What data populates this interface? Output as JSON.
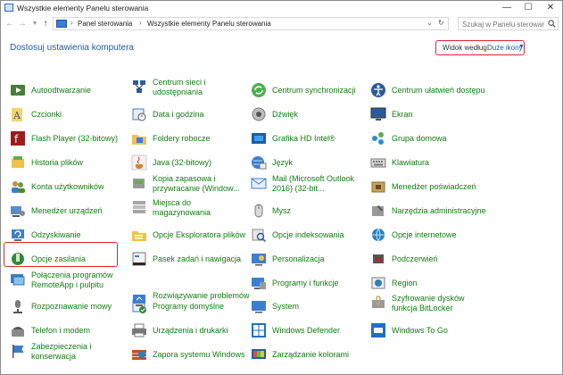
{
  "window": {
    "title": "Wszystkie elementy Panelu sterowania"
  },
  "address": {
    "crumbs": [
      "Panel sterowania",
      "Wszystkie elementy Panelu sterowania"
    ],
    "search_placeholder": "Szukaj w Panelu sterowania"
  },
  "header": {
    "title": "Dostosuj ustawienia komputera",
    "view_by_label": "Widok według:",
    "view_by_value": "Duże ikony"
  },
  "colors": {
    "link_green": "#107c10",
    "heading_blue": "#1e5aa8",
    "highlight_red": "#e0242f"
  },
  "items": {
    "c1": [
      {
        "label": "Autoodtwarzanie",
        "icon": "autoplay-icon"
      },
      {
        "label": "Czcionki",
        "icon": "fonts-icon"
      },
      {
        "label": "Flash Player (32-bitowy)",
        "icon": "flash-icon"
      },
      {
        "label": "Historia plików",
        "icon": "file-history-icon"
      },
      {
        "label": "Konta użytkowników",
        "icon": "user-accounts-icon"
      },
      {
        "label": "Menedżer urządzeń",
        "icon": "device-manager-icon"
      },
      {
        "label": "Odzyskiwanie",
        "icon": "recovery-icon"
      },
      {
        "label": "Opcje zasilania",
        "icon": "power-options-icon"
      },
      {
        "label": "Połączenia programów RemoteApp i pulpitu",
        "icon": "remoteapp-icon"
      },
      {
        "label": "Rozpoznawanie mowy",
        "icon": "speech-icon"
      },
      {
        "label": "Telefon i modem",
        "icon": "phone-modem-icon"
      },
      {
        "label": "Zabezpieczenia i konserwacja",
        "icon": "security-flag-icon"
      }
    ],
    "c2": [
      {
        "label": "Centrum sieci i udostępniania",
        "icon": "network-icon"
      },
      {
        "label": "Data i godzina",
        "icon": "date-time-icon"
      },
      {
        "label": "Foldery robocze",
        "icon": "work-folders-icon"
      },
      {
        "label": "Java (32-bitowy)",
        "icon": "java-icon"
      },
      {
        "label": "Kopia zapasowa i przywracanie (Window...",
        "icon": "backup-icon"
      },
      {
        "label": "Miejsca do magazynowania",
        "icon": "storage-icon"
      },
      {
        "label": "Opcje Eksploratora plików",
        "icon": "explorer-options-icon"
      },
      {
        "label": "Pasek zadań i nawigacja",
        "icon": "taskbar-icon"
      },
      {
        "label": "Programy domyślne",
        "icon": "default-programs-icon"
      },
      {
        "label": "Rozwiązywanie problemów",
        "icon": "troubleshoot-icon"
      },
      {
        "label": "Urządzenia i drukarki",
        "icon": "printer-icon"
      },
      {
        "label": "Zapora systemu Windows",
        "icon": "firewall-icon"
      }
    ],
    "c3": [
      {
        "label": "Centrum synchronizacji",
        "icon": "sync-icon"
      },
      {
        "label": "Dźwięk",
        "icon": "sound-icon"
      },
      {
        "label": "Grafika HD Intel®",
        "icon": "intel-graphics-icon"
      },
      {
        "label": "Język",
        "icon": "language-icon"
      },
      {
        "label": "Mail (Microsoft Outlook 2016) (32-bit...",
        "icon": "mail-icon"
      },
      {
        "label": "Mysz",
        "icon": "mouse-icon"
      },
      {
        "label": "Opcje indeksowania",
        "icon": "indexing-icon"
      },
      {
        "label": "Personalizacja",
        "icon": "personalization-icon"
      },
      {
        "label": "Programy i funkcje",
        "icon": "programs-icon"
      },
      {
        "label": "System",
        "icon": "system-icon"
      },
      {
        "label": "Windows Defender",
        "icon": "defender-icon"
      },
      {
        "label": "Zarządzanie kolorami",
        "icon": "color-management-icon"
      }
    ],
    "c4": [
      {
        "label": "Centrum ułatwień dostępu",
        "icon": "ease-of-access-icon"
      },
      {
        "label": "Ekran",
        "icon": "display-icon"
      },
      {
        "label": "Grupa domowa",
        "icon": "homegroup-icon"
      },
      {
        "label": "Klawiatura",
        "icon": "keyboard-icon"
      },
      {
        "label": "Menedżer poświadczeń",
        "icon": "credential-icon"
      },
      {
        "label": "Narzędzia administracyjne",
        "icon": "admin-tools-icon"
      },
      {
        "label": "Opcje internetowe",
        "icon": "internet-options-icon"
      },
      {
        "label": "Podczerwień",
        "icon": "infrared-icon"
      },
      {
        "label": "Region",
        "icon": "region-icon"
      },
      {
        "label": "Szyfrowanie dysków funkcja BitLocker",
        "icon": "bitlocker-icon"
      },
      {
        "label": "Windows To Go",
        "icon": "windows-to-go-icon"
      }
    ]
  }
}
